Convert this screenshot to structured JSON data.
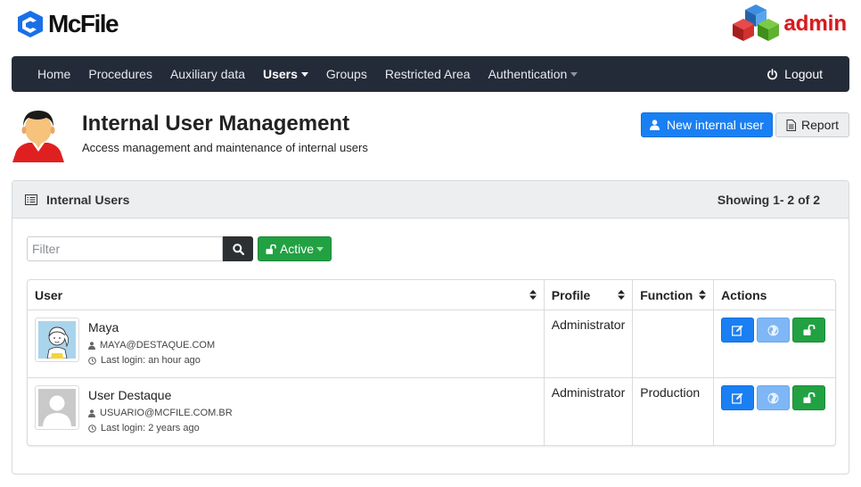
{
  "brand": {
    "name": "McFile",
    "admin_label": "admin"
  },
  "nav": {
    "items": [
      {
        "label": "Home"
      },
      {
        "label": "Procedures"
      },
      {
        "label": "Auxiliary data"
      },
      {
        "label": "Users"
      },
      {
        "label": "Groups"
      },
      {
        "label": "Restricted Area"
      },
      {
        "label": "Authentication"
      }
    ],
    "logout": "Logout"
  },
  "header": {
    "title": "Internal User Management",
    "subtitle": "Access management and maintenance of internal users",
    "new_button": "New internal user",
    "report_button": "Report"
  },
  "panel": {
    "title": "Internal Users",
    "count": "Showing 1- 2 of 2",
    "filter_placeholder": "Filter",
    "status_button": "Active"
  },
  "table": {
    "columns": [
      "User",
      "Profile",
      "Function",
      "Actions"
    ],
    "rows": [
      {
        "name": "Maya",
        "email": "MAYA@DESTAQUE.COM",
        "last_login": "Last login: an hour ago",
        "profile": "Administrator",
        "function": ""
      },
      {
        "name": "User Destaque",
        "email": "USUARIO@MCFILE.COM.BR",
        "last_login": "Last login: 2 years ago",
        "profile": "Administrator",
        "function": "Production"
      }
    ]
  },
  "colors": {
    "navbar": "#242b38",
    "primary": "#1a7ff2",
    "success": "#22a143",
    "light_primary": "#7fb6f6"
  }
}
